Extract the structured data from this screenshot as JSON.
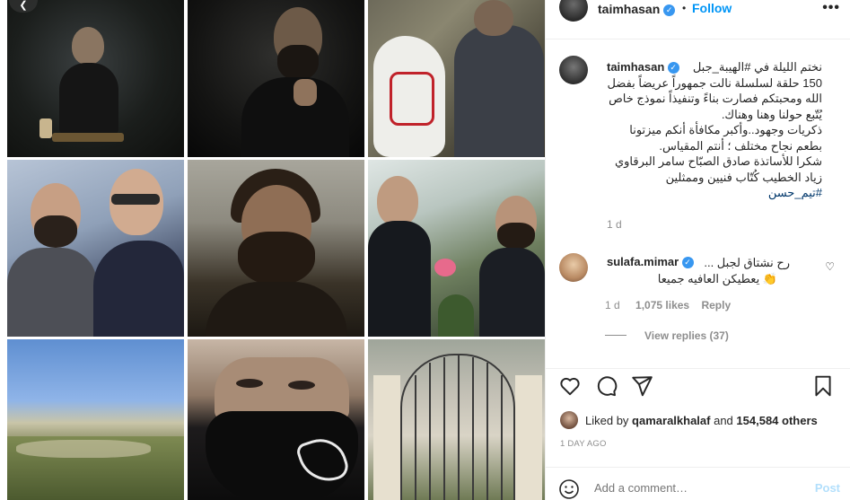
{
  "header": {
    "username": "taimhasan",
    "separator": "•",
    "follow_label": "Follow",
    "more_label": "•••"
  },
  "caption": {
    "username": "taimhasan",
    "lines": [
      "نختم الليلة في #الهيبة_جبل",
      "150 حلقة لسلسلة نالت جمهوراً عريضاً بفضل",
      "الله ومحبتكم فصارت بناءً وتنفيذاً نموذج خاص",
      "يُتّبع حولنا وهنا وهناك.",
      "ذكريات وجهود..وأكبر مكافأة أنكم ميزتونا",
      "بطعم نجاح مختلف ؛ أنتم المقياس.",
      "شكرا للأساتذة صادق الصبّاح سامر البرقاوي",
      "زياد الخطيب كُتّاب فنيين وممثلين",
      "#تيم_حسن"
    ],
    "time": "1 d"
  },
  "comment": {
    "username": "sulafa.mimar",
    "line1": "رح نشتاق لجبل ...",
    "line2": "👏 يعطيكن العافيه جميعا",
    "time": "1 d",
    "likes": "1,075 likes",
    "reply_label": "Reply",
    "view_replies": "View replies (37)"
  },
  "likes": {
    "prefix": "Liked by ",
    "user": "qamaralkhalaf",
    "middle": " and ",
    "others": "154,584 others"
  },
  "time_ago": "1 DAY AGO",
  "add_comment": {
    "placeholder": "Add a comment…",
    "post_label": "Post"
  },
  "grid": {
    "corner_icon": "❮"
  },
  "colors": {
    "link": "#0095f6",
    "hashtag": "#00376b",
    "muted": "#8e8e8e",
    "post_disabled": "#b2dffc",
    "verified": "#3897f0"
  }
}
